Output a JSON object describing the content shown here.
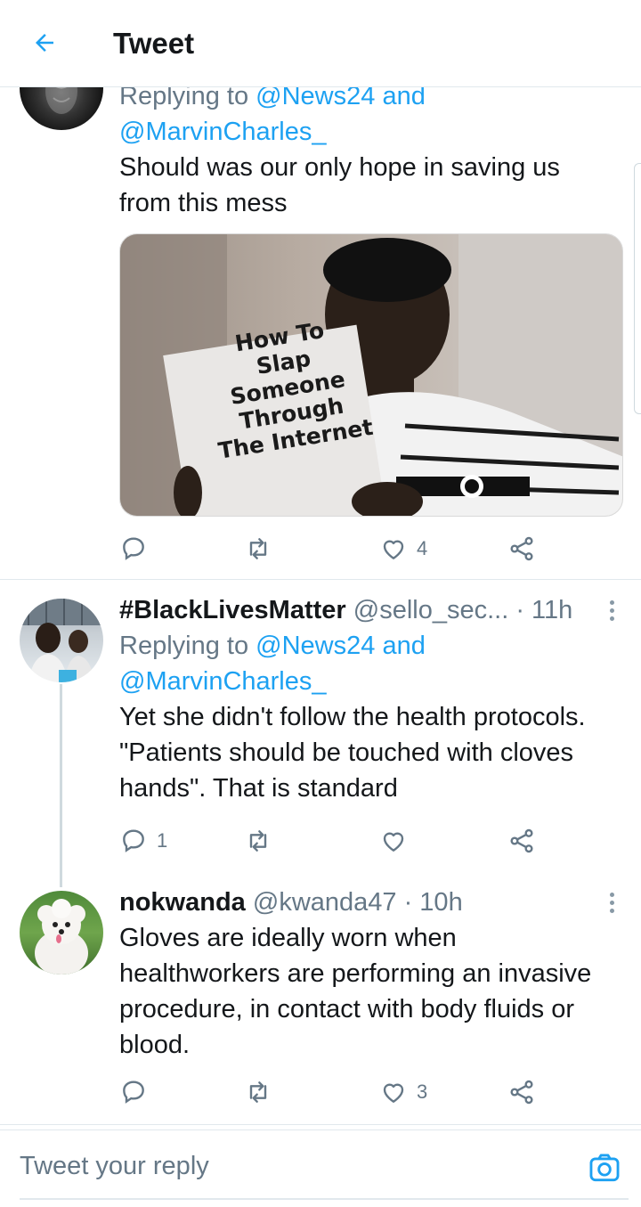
{
  "header": {
    "title": "Tweet"
  },
  "tweets": [
    {
      "reply_prefix": "Replying to",
      "mention1": "@News24",
      "and": "and",
      "mention2": "@MarvinCharles_",
      "lines": [
        "Should was our only hope in saving us",
        "from this mess"
      ],
      "media_text": [
        "How To",
        "Slap",
        "Someone",
        "Through",
        "The Internet"
      ],
      "reply_count": "",
      "retweet_count": "",
      "like_count": "4"
    },
    {
      "name": "#BlackLivesMatter",
      "handle": "@sello_sec...",
      "time": "· 11h",
      "reply_prefix": "Replying to",
      "mention1": "@News24",
      "and": "and",
      "mention2": "@MarvinCharles_",
      "lines": [
        "Yet she didn't follow the health protocols.",
        "\"Patients should be touched with cloves",
        "hands\". That is standard"
      ],
      "reply_count": "1",
      "retweet_count": "",
      "like_count": ""
    },
    {
      "name": "nokwanda",
      "handle": "@kwanda47",
      "time": "· 10h",
      "lines": [
        "Gloves are ideally worn when",
        "healthworkers are performing an invasive",
        "procedure, in contact with body fluids or",
        "blood."
      ],
      "reply_count": "",
      "retweet_count": "",
      "like_count": "3"
    }
  ],
  "reply_bar": {
    "placeholder": "Tweet your reply"
  },
  "icons": {
    "back": "arrow-left-icon",
    "reply": "comment-icon",
    "retweet": "retweet-icon",
    "like": "heart-icon",
    "share": "share-icon",
    "more": "more-vertical-icon",
    "camera": "camera-icon"
  },
  "colors": {
    "accent": "#1da1f2",
    "secondary_text": "#657786",
    "divider": "#e1e8ed"
  }
}
